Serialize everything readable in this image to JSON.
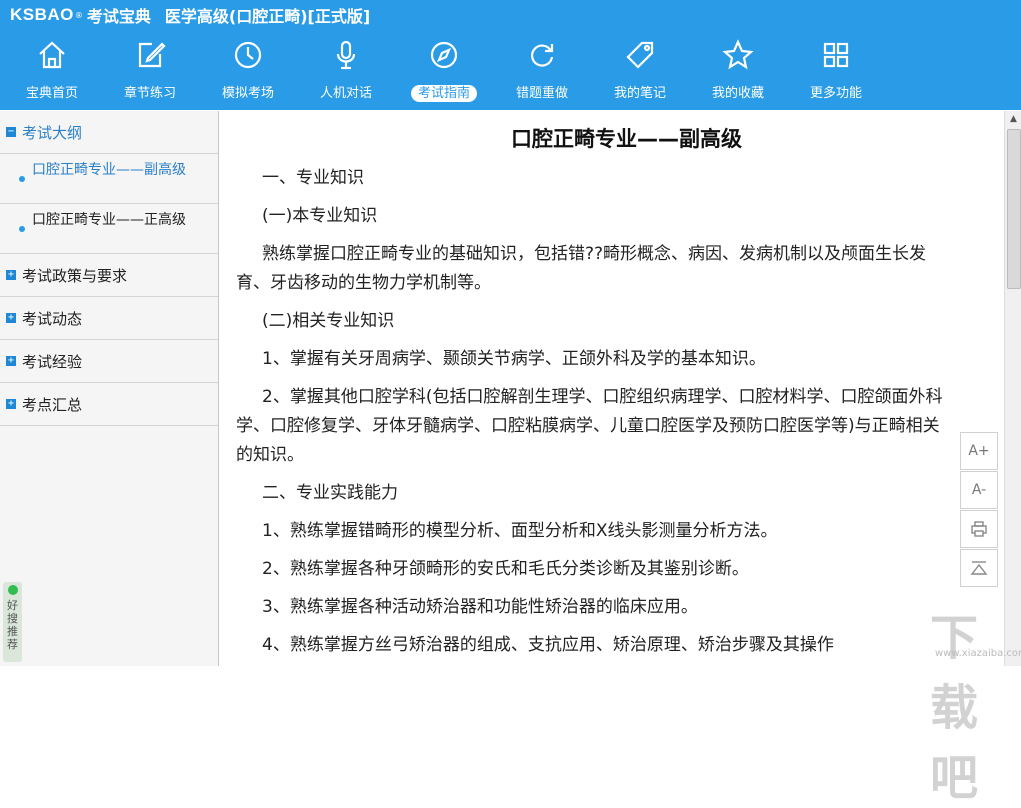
{
  "header": {
    "brand": "KSBAO",
    "brand_reg": "®",
    "brand_cn": "考试宝典",
    "app_title": "医学高级(口腔正畸)[正式版]"
  },
  "nav": [
    {
      "label": "宝典首页",
      "icon": "home-icon"
    },
    {
      "label": "章节练习",
      "icon": "edit-icon"
    },
    {
      "label": "模拟考场",
      "icon": "clock-icon"
    },
    {
      "label": "人机对话",
      "icon": "microphone-icon"
    },
    {
      "label": "考试指南",
      "icon": "compass-icon",
      "active": true
    },
    {
      "label": "错题重做",
      "icon": "refresh-icon"
    },
    {
      "label": "我的笔记",
      "icon": "tag-icon"
    },
    {
      "label": "我的收藏",
      "icon": "star-icon"
    },
    {
      "label": "更多功能",
      "icon": "grid-icon"
    }
  ],
  "sidebar": {
    "sections": [
      {
        "label": "考试大纲",
        "expanded": true,
        "toggle": "−",
        "items": [
          {
            "label": "口腔正畸专业——副高级",
            "selected": true
          },
          {
            "label": "口腔正畸专业——正高级",
            "selected": false
          }
        ]
      },
      {
        "label": "考试政策与要求",
        "expanded": false,
        "toggle": "+"
      },
      {
        "label": "考试动态",
        "expanded": false,
        "toggle": "+"
      },
      {
        "label": "考试经验",
        "expanded": false,
        "toggle": "+"
      },
      {
        "label": "考点汇总",
        "expanded": false,
        "toggle": "+"
      }
    ]
  },
  "haosou": {
    "label": "好搜推荐"
  },
  "document": {
    "title": "口腔正畸专业——副高级",
    "paragraphs": [
      "一、专业知识",
      "(一)本专业知识",
      "熟练掌握口腔正畸专业的基础知识，包括错??畸形概念、病因、发病机制以及颅面生长发育、牙齿移动的生物力学机制等。",
      "(二)相关专业知识",
      "1、掌握有关牙周病学、颞颌关节病学、正颌外科及学的基本知识。",
      "2、掌握其他口腔学科(包括口腔解剖生理学、口腔组织病理学、口腔材料学、口腔颌面外科学、口腔修复学、牙体牙髓病学、口腔粘膜病学、儿童口腔医学及预防口腔医学等)与正畸相关的知识。",
      "二、专业实践能力",
      "1、熟练掌握错畸形的模型分析、面型分析和X线头影测量分析方法。",
      "2、熟练掌握各种牙颌畸形的安氏和毛氏分类诊断及其鉴别诊断。",
      "3、熟练掌握各种活动矫治器和功能性矫治器的临床应用。",
      "4、熟练掌握方丝弓矫治器的组成、支抗应用、矫治原理、矫治步骤及其操作"
    ]
  },
  "tools": {
    "font_up": "A+",
    "font_down": "A-",
    "print_icon": "printer-icon",
    "top_icon": "back-to-top-icon"
  },
  "watermark": {
    "text": "下载吧",
    "url": "www.xiazaiba.com"
  }
}
